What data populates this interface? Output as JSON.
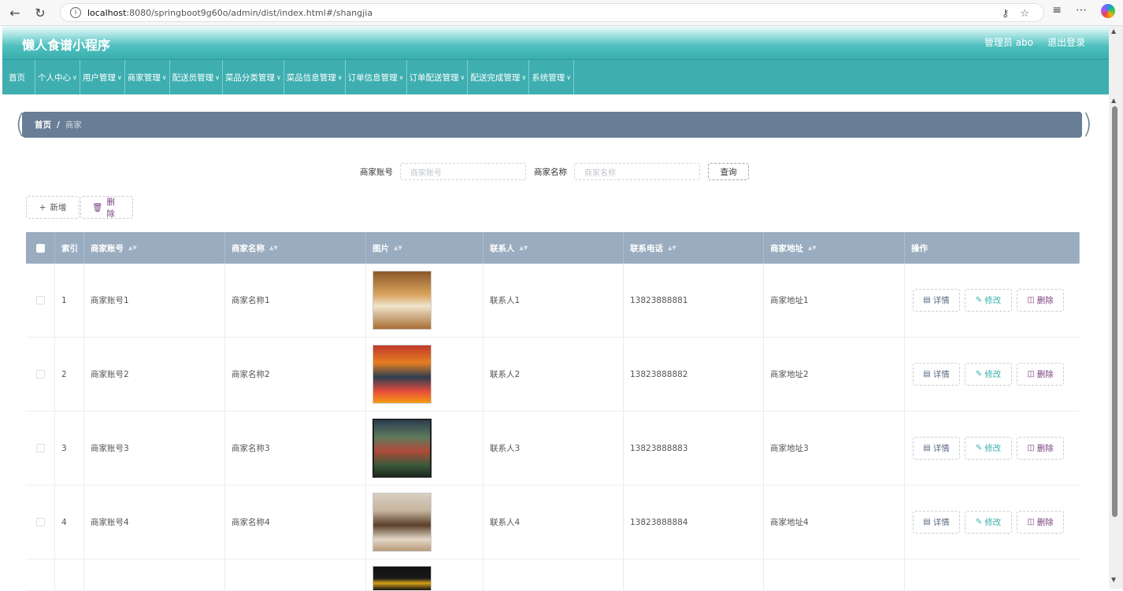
{
  "browser": {
    "url_host": "localhost",
    "url_rest": ":8080/springboot9g60o/admin/dist/index.html#/shangjia"
  },
  "header": {
    "title": "懒人食谱小程序",
    "user": "管理员 abo",
    "logout": "退出登录"
  },
  "menu": {
    "items": [
      {
        "label": "首页",
        "chevron": false
      },
      {
        "label": "个人中心",
        "chevron": true
      },
      {
        "label": "用户管理",
        "chevron": true
      },
      {
        "label": "商家管理",
        "chevron": true
      },
      {
        "label": "配送员管理",
        "chevron": true
      },
      {
        "label": "菜品分类管理",
        "chevron": true
      },
      {
        "label": "菜品信息管理",
        "chevron": true
      },
      {
        "label": "订单信息管理",
        "chevron": true
      },
      {
        "label": "订单配送管理",
        "chevron": true
      },
      {
        "label": "配送完成管理",
        "chevron": true
      },
      {
        "label": "系统管理",
        "chevron": true
      }
    ]
  },
  "breadcrumb": {
    "home": "首页",
    "separator": "/",
    "current": "商家"
  },
  "search": {
    "account_label": "商家账号",
    "account_placeholder": "商家账号",
    "name_label": "商家名称",
    "name_placeholder": "商家名称",
    "query_button": "查询"
  },
  "actions": {
    "add": "新增",
    "delete": "删除"
  },
  "table": {
    "headers": [
      "索引",
      "商家账号",
      "商家名称",
      "图片",
      "联系人",
      "联系电话",
      "商家地址",
      "操作"
    ],
    "rows": [
      {
        "index": "1",
        "account": "商家账号1",
        "name": "商家名称1",
        "contact": "联系人1",
        "phone": "13823888881",
        "address": "商家地址1"
      },
      {
        "index": "2",
        "account": "商家账号2",
        "name": "商家名称2",
        "contact": "联系人2",
        "phone": "13823888882",
        "address": "商家地址2"
      },
      {
        "index": "3",
        "account": "商家账号3",
        "name": "商家名称3",
        "contact": "联系人3",
        "phone": "13823888883",
        "address": "商家地址3"
      },
      {
        "index": "4",
        "account": "商家账号4",
        "name": "商家名称4",
        "contact": "联系人4",
        "phone": "13823888884",
        "address": "商家地址4"
      }
    ],
    "row_actions": {
      "detail": "详情",
      "edit": "修改",
      "delete": "删除"
    }
  },
  "colors": {
    "header_teal": "#3aafae",
    "menu_teal": "#3eaeb0",
    "breadcrumb_bg": "#687d96",
    "table_header_bg": "#9aacbf",
    "delete_purple": "#7b3f7f"
  }
}
